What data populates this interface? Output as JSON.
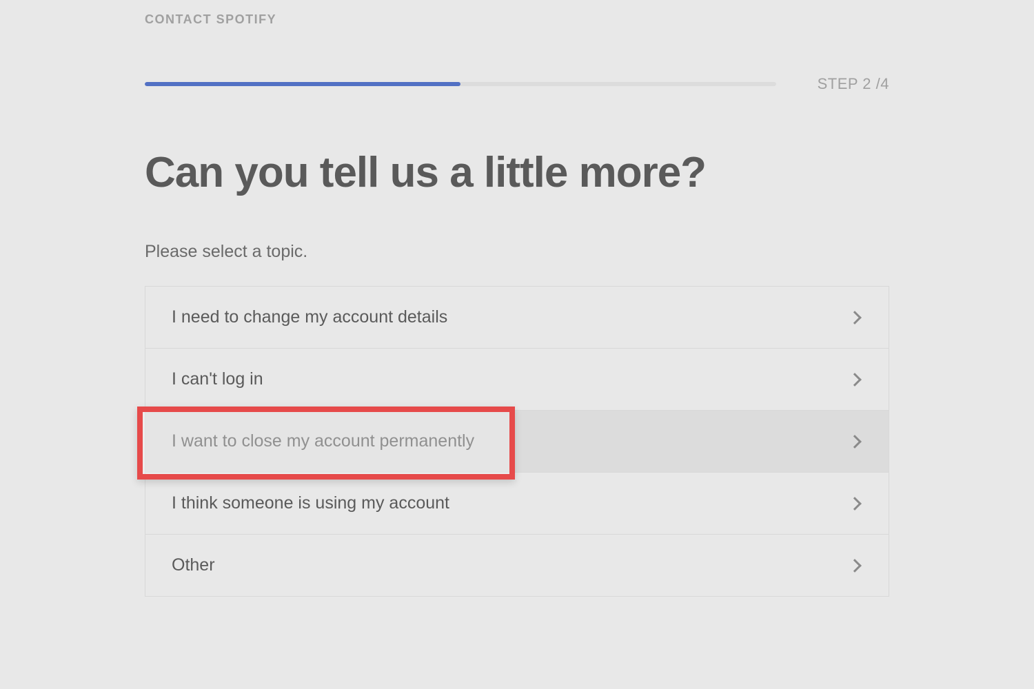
{
  "breadcrumb": "CONTACT SPOTIFY",
  "step_label": "STEP 2 /4",
  "progress_percent": 50,
  "heading": "Can you tell us a little more?",
  "subheading": "Please select a topic.",
  "topics": [
    {
      "label": "I need to change my account details"
    },
    {
      "label": "I can't log in"
    },
    {
      "label": "I want to close my account permanently"
    },
    {
      "label": "I think someone is using my account"
    },
    {
      "label": "Other"
    }
  ],
  "highlight_index": 2,
  "colors": {
    "accent": "#5271c4",
    "highlight_border": "#e64a4a",
    "background": "#e8e8e8"
  }
}
